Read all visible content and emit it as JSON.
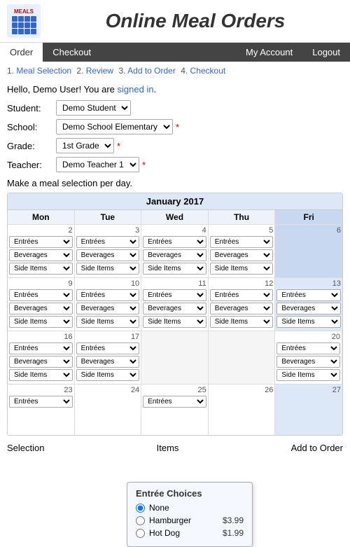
{
  "header": {
    "logo_text": "MEALS",
    "site_title": "Online Meal Orders"
  },
  "nav": {
    "left": [
      {
        "label": "Order",
        "active": true
      },
      {
        "label": "Checkout",
        "active": false
      }
    ],
    "right": [
      {
        "label": "My Account"
      },
      {
        "label": "Logout"
      }
    ]
  },
  "breadcrumb": {
    "steps": [
      {
        "num": "1.",
        "label": "Meal Selection",
        "active": true
      },
      {
        "num": "2.",
        "label": "Review"
      },
      {
        "num": "3.",
        "label": "Add to Order"
      },
      {
        "num": "4.",
        "label": "Checkout"
      }
    ]
  },
  "hello": "Hello, Demo User! You are signed in.",
  "form": {
    "student_label": "Student:",
    "student_value": "Demo Student",
    "school_label": "School:",
    "school_value": "Demo School Elementary",
    "grade_label": "Grade:",
    "grade_value": "1st Grade",
    "teacher_label": "Teacher:",
    "teacher_value": "Demo Teacher 1"
  },
  "meal_instruction": "Make a meal selection per day.",
  "calendar": {
    "month_label": "January 2017",
    "day_names": [
      "Mon",
      "Tue",
      "Wed",
      "Thu",
      "Fri"
    ],
    "weeks": [
      [
        {
          "num": "2",
          "selects": [
            "Entrées",
            "Beverages",
            "Side Items"
          ]
        },
        {
          "num": "3",
          "selects": [
            "Entrées",
            "Beverages",
            "Side Items"
          ]
        },
        {
          "num": "4",
          "selects": [
            "Entrées",
            "Beverages",
            "Side Items"
          ]
        },
        {
          "num": "5",
          "selects": [
            "Entrées",
            "Beverages",
            "Side Items"
          ]
        },
        {
          "num": "6",
          "selects": [],
          "style": "fri"
        }
      ],
      [
        {
          "num": "9",
          "selects": [
            "Entrées",
            "Beverages",
            "Side Items"
          ]
        },
        {
          "num": "10",
          "selects": [
            "Entrées",
            "Beverages",
            "Side Items"
          ]
        },
        {
          "num": "11",
          "selects": [
            "Entrées",
            "Beverages",
            "Side Items"
          ]
        },
        {
          "num": "12",
          "selects": [
            "Entrées",
            "Beverages",
            "Side Items"
          ]
        },
        {
          "num": "13",
          "selects": [
            "Entrées",
            "Beverages",
            "Side Items"
          ]
        }
      ],
      [
        {
          "num": "16",
          "selects": [
            "Entrées",
            "Beverages",
            "Side Items"
          ]
        },
        {
          "num": "17",
          "selects": [
            "Entrées",
            "Beverages",
            "Side Items"
          ]
        },
        {
          "num": "",
          "selects": [],
          "style": "empty"
        },
        {
          "num": "",
          "selects": [],
          "style": "empty"
        },
        {
          "num": "20",
          "selects": [
            "Entrées",
            "Beverages",
            "Side Items"
          ]
        }
      ],
      [
        {
          "num": "23",
          "selects": [
            "Entrées"
          ]
        },
        {
          "num": "24",
          "selects": []
        },
        {
          "num": "25",
          "selects": [
            "Entrées"
          ]
        },
        {
          "num": "26",
          "selects": []
        },
        {
          "num": "27",
          "selects": []
        }
      ]
    ]
  },
  "entree_popup": {
    "title": "Entrée Choices",
    "options": [
      {
        "label": "None",
        "price": "",
        "selected": true
      },
      {
        "label": "Hamburger",
        "price": "$3.99",
        "selected": false
      },
      {
        "label": "Hot Dog",
        "price": "$1.99",
        "selected": false
      }
    ]
  },
  "footer": {
    "items_label": "Items",
    "add_to_order_label": "Add to Order",
    "selection_label": "Selection"
  }
}
